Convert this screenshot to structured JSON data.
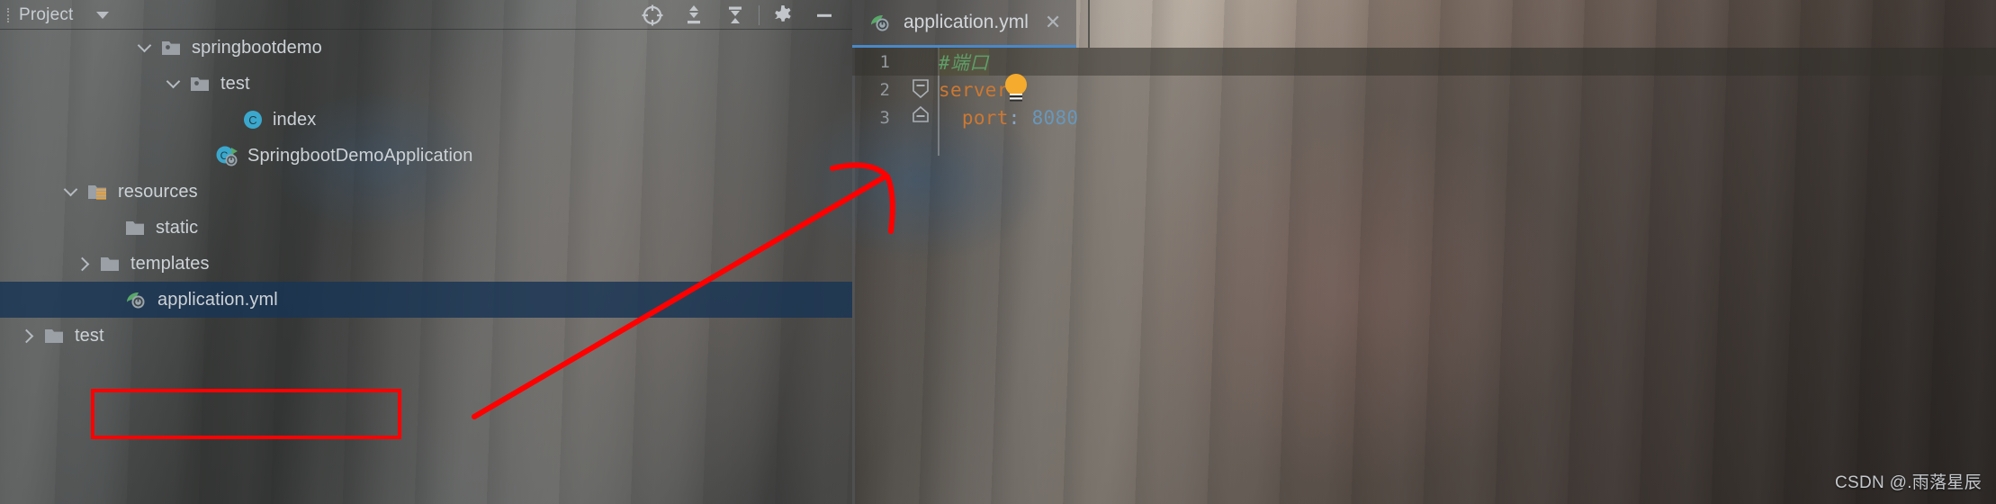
{
  "window": {
    "watermark": "CSDN @.雨落星辰"
  },
  "project_panel": {
    "title": "Project",
    "combo_icon": "chevron-down-icon",
    "toolbar": [
      {
        "name": "locate-icon",
        "label": "Select Opened File"
      },
      {
        "name": "expand-all-icon",
        "label": "Expand All"
      },
      {
        "name": "collapse-all-icon",
        "label": "Collapse All"
      },
      {
        "name": "gear-icon",
        "label": "Settings"
      },
      {
        "name": "minimize-icon",
        "label": "Hide"
      }
    ],
    "tree": [
      {
        "label": "springbootdemo",
        "indent": 1,
        "twisty": "down",
        "icon": "folder-module-icon",
        "selected": false
      },
      {
        "label": "test",
        "indent": 2,
        "twisty": "down",
        "icon": "folder-module-icon",
        "selected": false
      },
      {
        "label": "index",
        "indent": 3,
        "twisty": "none",
        "icon": "java-class-icon",
        "selected": false
      },
      {
        "label": "SpringbootDemoApplication",
        "indent": 2,
        "twisty": "none",
        "icon": "spring-boot-class-icon",
        "selected": false
      },
      {
        "label": "resources",
        "indent": 0,
        "twisty": "down",
        "icon": "folder-resources-icon",
        "selected": false
      },
      {
        "label": "static",
        "indent": 1,
        "twisty": "none",
        "icon": "folder-icon",
        "selected": false
      },
      {
        "label": "templates",
        "indent": 1,
        "twisty": "right",
        "icon": "folder-icon",
        "selected": false
      },
      {
        "label": "application.yml",
        "indent": 1,
        "twisty": "none",
        "icon": "spring-yaml-icon",
        "selected": true
      },
      {
        "label": "test",
        "indent": 0,
        "twisty": "right",
        "icon": "folder-icon",
        "selected": false
      }
    ]
  },
  "editor": {
    "tab": {
      "label": "application.yml",
      "icon": "spring-yaml-icon",
      "close_label": "✕"
    },
    "lines": [
      {
        "number": "1",
        "tokens": [
          {
            "text": "#端口",
            "type": "comment"
          }
        ]
      },
      {
        "number": "2",
        "tokens": [
          {
            "text": "server",
            "type": "key"
          },
          {
            "text": ":",
            "type": "colon"
          }
        ]
      },
      {
        "number": "3",
        "tokens": [
          {
            "text": "  port",
            "type": "key"
          },
          {
            "text": ": ",
            "type": "colon"
          },
          {
            "text": "8080",
            "type": "num"
          }
        ]
      }
    ],
    "hint_icon": "lightbulb-icon"
  },
  "annotations": {
    "red_box_target": "application.yml",
    "arrow": "red-arrow-pointing-to-editor",
    "color": "#ff0000"
  },
  "colors": {
    "selection_blue": "#183454",
    "tab_underline": "#4a88c7",
    "comment_green": "#5f9e68",
    "yaml_key_orange": "#cc7832",
    "number_blue": "#6897bb",
    "annotation_red": "#ff0000"
  }
}
